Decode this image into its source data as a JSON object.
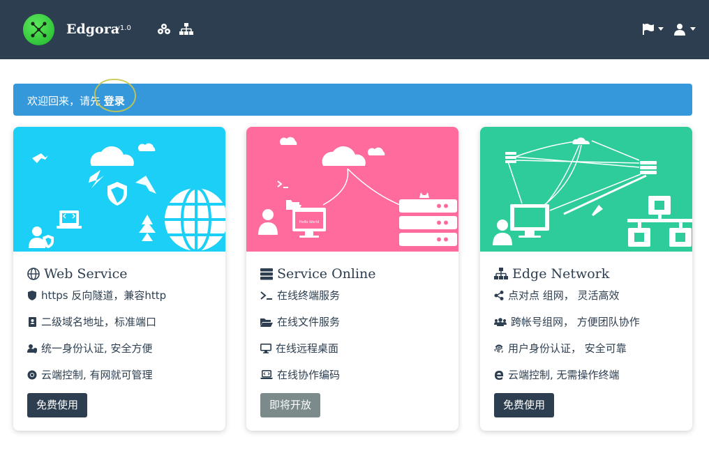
{
  "navbar": {
    "brand": "Edgora",
    "version": "v1.0",
    "icons": [
      "cubes-icon",
      "network-icon",
      "flag-icon",
      "user-icon"
    ]
  },
  "alert": {
    "text": "欢迎回来，请先",
    "link": "登录"
  },
  "cards": [
    {
      "title": "Web Service",
      "title_icon": "globe-icon",
      "features": [
        {
          "icon": "shield-icon",
          "text": "https 反向隧道，兼容http"
        },
        {
          "icon": "address-book-icon",
          "text": "二级域名地址，标准端口"
        },
        {
          "icon": "user-shield-icon",
          "text": "统一身份认证, 安全方便"
        },
        {
          "icon": "chrome-icon",
          "text": "云端控制, 有网就可管理"
        }
      ],
      "button": "免费使用",
      "color": "#1ccff7"
    },
    {
      "title": "Service Online",
      "title_icon": "server-icon",
      "features": [
        {
          "icon": "terminal-icon",
          "text": "在线终端服务"
        },
        {
          "icon": "folder-open-icon",
          "text": "在线文件服务"
        },
        {
          "icon": "desktop-icon",
          "text": "在线远程桌面"
        },
        {
          "icon": "laptop-code-icon",
          "text": "在线协作编码"
        }
      ],
      "button": "即将开放",
      "color": "#ff6b9d",
      "illustration_text": "Hello World"
    },
    {
      "title": "Edge Network",
      "title_icon": "sitemap-icon",
      "features": [
        {
          "icon": "share-icon",
          "text": "点对点 组网， 灵活高效"
        },
        {
          "icon": "users-icon",
          "text": "跨帐号组网， 方便团队协作"
        },
        {
          "icon": "fingerprint-icon",
          "text": "用户身份认证， 安全可靠"
        },
        {
          "icon": "edge-icon",
          "text": "云端控制, 无需操作终端"
        }
      ],
      "button": "免费使用",
      "color": "#2ecc9a"
    }
  ]
}
